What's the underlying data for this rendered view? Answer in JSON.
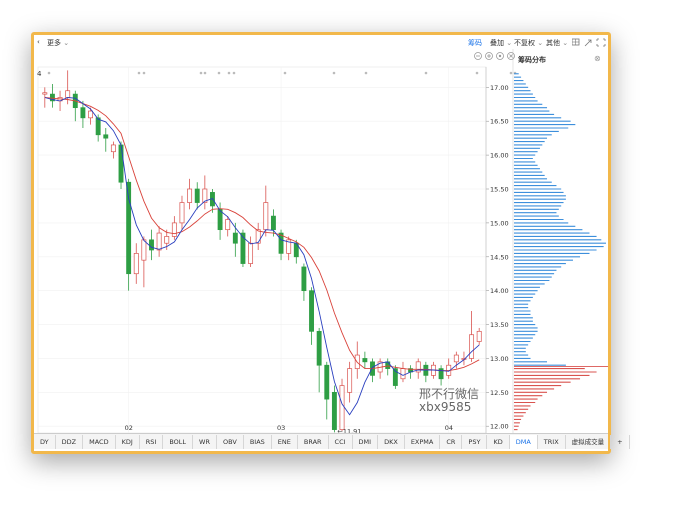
{
  "toolbar": {
    "back": "‹",
    "more": "更多",
    "active_tab": "筹码",
    "overlay": "叠加",
    "adjust": "不复权",
    "other": "其他",
    "dropdown_glyph": "⌄"
  },
  "panel": {
    "title": "筹码分布",
    "close": "⊗"
  },
  "watermark": {
    "line1": "邢不行微信",
    "line2": "xbx9585"
  },
  "top_marker": "4",
  "chart_data": {
    "type": "candlestick",
    "x_labels": [
      "02",
      "03",
      "04"
    ],
    "y_ticks": [
      "17.00",
      "16.50",
      "16.00",
      "15.50",
      "15.00",
      "14.50",
      "14.00",
      "13.50",
      "13.00",
      "12.50",
      "12.00"
    ],
    "y_range": [
      11.9,
      17.3
    ],
    "low_marker": "11.91",
    "candles": [
      [
        16.9,
        16.92,
        16.7,
        17.0
      ],
      [
        16.9,
        16.8,
        16.7,
        17.05
      ],
      [
        16.8,
        16.85,
        16.65,
        16.95
      ],
      [
        16.85,
        16.95,
        16.75,
        17.25
      ],
      [
        16.9,
        16.7,
        16.5,
        16.95
      ],
      [
        16.7,
        16.55,
        16.4,
        16.8
      ],
      [
        16.55,
        16.65,
        16.45,
        16.7
      ],
      [
        16.55,
        16.3,
        16.2,
        16.6
      ],
      [
        16.3,
        16.25,
        16.05,
        16.4
      ],
      [
        16.05,
        16.15,
        15.95,
        16.2
      ],
      [
        16.15,
        15.6,
        15.5,
        16.2
      ],
      [
        15.6,
        14.25,
        14.0,
        15.65
      ],
      [
        14.25,
        14.55,
        14.1,
        14.7
      ],
      [
        14.45,
        14.75,
        14.05,
        14.8
      ],
      [
        14.75,
        14.6,
        14.45,
        14.9
      ],
      [
        14.6,
        14.85,
        14.5,
        14.95
      ],
      [
        14.7,
        14.8,
        14.6,
        14.9
      ],
      [
        14.8,
        15.0,
        14.75,
        15.1
      ],
      [
        15.0,
        15.3,
        14.9,
        15.4
      ],
      [
        15.3,
        15.5,
        15.2,
        15.65
      ],
      [
        15.5,
        15.3,
        15.2,
        15.6
      ],
      [
        15.3,
        15.5,
        15.2,
        15.7
      ],
      [
        15.45,
        15.25,
        15.15,
        15.5
      ],
      [
        15.2,
        14.9,
        14.75,
        15.3
      ],
      [
        14.9,
        15.05,
        14.8,
        15.1
      ],
      [
        14.85,
        14.7,
        14.5,
        15.0
      ],
      [
        14.85,
        14.4,
        14.35,
        14.9
      ],
      [
        14.4,
        14.7,
        14.35,
        14.8
      ],
      [
        14.7,
        14.9,
        14.6,
        15.0
      ],
      [
        14.9,
        15.3,
        14.8,
        15.55
      ],
      [
        15.1,
        14.9,
        14.8,
        15.2
      ],
      [
        14.85,
        14.55,
        14.45,
        14.9
      ],
      [
        14.55,
        14.75,
        14.45,
        14.8
      ],
      [
        14.7,
        14.5,
        14.4,
        14.75
      ],
      [
        14.35,
        14.0,
        13.85,
        14.4
      ],
      [
        14.0,
        13.4,
        13.2,
        14.05
      ],
      [
        13.4,
        12.9,
        12.5,
        13.45
      ],
      [
        12.9,
        12.4,
        12.1,
        12.95
      ],
      [
        12.5,
        11.95,
        11.91,
        12.6
      ],
      [
        11.95,
        12.6,
        11.93,
        12.7
      ],
      [
        12.5,
        12.85,
        12.35,
        12.95
      ],
      [
        12.85,
        13.05,
        12.7,
        13.25
      ],
      [
        13.0,
        12.95,
        12.85,
        13.1
      ],
      [
        12.95,
        12.75,
        12.65,
        13.0
      ],
      [
        12.8,
        12.95,
        12.7,
        13.0
      ],
      [
        12.95,
        12.85,
        12.75,
        13.0
      ],
      [
        12.85,
        12.6,
        12.55,
        12.9
      ],
      [
        12.7,
        12.85,
        12.65,
        12.95
      ],
      [
        12.85,
        12.8,
        12.7,
        12.9
      ],
      [
        12.8,
        12.95,
        12.7,
        13.0
      ],
      [
        12.9,
        12.75,
        12.65,
        12.95
      ],
      [
        12.75,
        12.9,
        12.7,
        12.95
      ],
      [
        12.85,
        12.7,
        12.6,
        12.9
      ],
      [
        12.75,
        12.9,
        12.7,
        13.0
      ],
      [
        12.95,
        13.05,
        12.85,
        13.1
      ],
      [
        13.0,
        13.0,
        12.9,
        13.1
      ],
      [
        13.0,
        13.35,
        12.95,
        13.7
      ],
      [
        13.25,
        13.4,
        13.2,
        13.45
      ]
    ],
    "ma_short": [
      16.85,
      16.82,
      16.8,
      16.85,
      16.84,
      16.76,
      16.68,
      16.53,
      16.49,
      16.36,
      16.15,
      15.36,
      14.97,
      14.74,
      14.64,
      14.61,
      14.65,
      14.72,
      14.9,
      15.05,
      15.22,
      15.32,
      15.36,
      15.18,
      15.09,
      14.93,
      14.79,
      14.69,
      14.71,
      14.9,
      14.89,
      14.75,
      14.72,
      14.7,
      14.53,
      14.18,
      13.69,
      13.16,
      12.66,
      12.33,
      12.17,
      12.35,
      12.65,
      12.87,
      12.93,
      12.95,
      12.81,
      12.75,
      12.8,
      12.83,
      12.83,
      12.83,
      12.82,
      12.81,
      12.9,
      12.98,
      13.1,
      13.2
    ],
    "ma_long": [
      16.85,
      16.84,
      16.83,
      16.82,
      16.8,
      16.76,
      16.72,
      16.66,
      16.58,
      16.46,
      16.32,
      15.98,
      15.63,
      15.32,
      15.07,
      14.93,
      14.86,
      14.84,
      14.87,
      14.94,
      15.03,
      15.13,
      15.2,
      15.21,
      15.2,
      15.15,
      15.08,
      14.97,
      14.88,
      14.86,
      14.85,
      14.82,
      14.77,
      14.72,
      14.64,
      14.49,
      14.29,
      14.01,
      13.67,
      13.38,
      13.12,
      12.94,
      12.85,
      12.85,
      12.87,
      12.89,
      12.87,
      12.85,
      12.84,
      12.84,
      12.84,
      12.83,
      12.82,
      12.82,
      12.84,
      12.87,
      12.92,
      12.98
    ],
    "chip_distribution": [
      [
        17.2,
        4
      ],
      [
        17.15,
        6
      ],
      [
        17.1,
        8
      ],
      [
        17.05,
        10
      ],
      [
        17.0,
        12
      ],
      [
        16.95,
        14
      ],
      [
        16.9,
        16
      ],
      [
        16.85,
        18
      ],
      [
        16.8,
        20
      ],
      [
        16.75,
        24
      ],
      [
        16.7,
        28
      ],
      [
        16.65,
        30
      ],
      [
        16.6,
        34
      ],
      [
        16.55,
        40
      ],
      [
        16.5,
        48
      ],
      [
        16.45,
        52
      ],
      [
        16.4,
        46
      ],
      [
        16.35,
        38
      ],
      [
        16.3,
        32
      ],
      [
        16.25,
        28
      ],
      [
        16.2,
        26
      ],
      [
        16.15,
        24
      ],
      [
        16.1,
        22
      ],
      [
        16.05,
        20
      ],
      [
        16.0,
        18
      ],
      [
        15.95,
        16
      ],
      [
        15.9,
        18
      ],
      [
        15.85,
        20
      ],
      [
        15.8,
        22
      ],
      [
        15.75,
        24
      ],
      [
        15.7,
        26
      ],
      [
        15.65,
        28
      ],
      [
        15.6,
        32
      ],
      [
        15.55,
        36
      ],
      [
        15.5,
        40
      ],
      [
        15.45,
        42
      ],
      [
        15.4,
        44
      ],
      [
        15.35,
        44
      ],
      [
        15.3,
        42
      ],
      [
        15.25,
        40
      ],
      [
        15.2,
        38
      ],
      [
        15.15,
        36
      ],
      [
        15.1,
        38
      ],
      [
        15.05,
        42
      ],
      [
        15.0,
        46
      ],
      [
        14.95,
        52
      ],
      [
        14.9,
        58
      ],
      [
        14.85,
        64
      ],
      [
        14.8,
        70
      ],
      [
        14.75,
        74
      ],
      [
        14.7,
        78
      ],
      [
        14.65,
        76
      ],
      [
        14.6,
        70
      ],
      [
        14.55,
        64
      ],
      [
        14.5,
        56
      ],
      [
        14.45,
        50
      ],
      [
        14.4,
        44
      ],
      [
        14.35,
        40
      ],
      [
        14.3,
        36
      ],
      [
        14.25,
        34
      ],
      [
        14.2,
        32
      ],
      [
        14.15,
        30
      ],
      [
        14.1,
        26
      ],
      [
        14.05,
        22
      ],
      [
        14.0,
        20
      ],
      [
        13.95,
        18
      ],
      [
        13.9,
        16
      ],
      [
        13.85,
        14
      ],
      [
        13.8,
        12
      ],
      [
        13.75,
        12
      ],
      [
        13.7,
        14
      ],
      [
        13.65,
        14
      ],
      [
        13.6,
        16
      ],
      [
        13.55,
        16
      ],
      [
        13.5,
        18
      ],
      [
        13.45,
        20
      ],
      [
        13.4,
        20
      ],
      [
        13.35,
        18
      ],
      [
        13.3,
        16
      ],
      [
        13.25,
        14
      ],
      [
        13.2,
        12
      ],
      [
        13.15,
        10
      ],
      [
        13.1,
        10
      ],
      [
        13.05,
        12
      ],
      [
        13.0,
        14
      ],
      [
        12.95,
        28
      ],
      [
        12.9,
        44
      ],
      [
        12.85,
        60
      ],
      [
        12.8,
        70
      ],
      [
        12.75,
        64
      ],
      [
        12.7,
        56
      ],
      [
        12.65,
        48
      ],
      [
        12.6,
        40
      ],
      [
        12.55,
        34
      ],
      [
        12.5,
        28
      ],
      [
        12.45,
        24
      ],
      [
        12.4,
        20
      ],
      [
        12.35,
        18
      ],
      [
        12.3,
        14
      ],
      [
        12.25,
        12
      ],
      [
        12.2,
        10
      ],
      [
        12.15,
        8
      ],
      [
        12.1,
        6
      ],
      [
        12.05,
        5
      ],
      [
        12.0,
        4
      ],
      [
        11.95,
        3
      ]
    ],
    "current_price": 12.88,
    "colors": {
      "up": "#d9534f",
      "down": "#2e9e44",
      "ma_short": "#2a3fbf",
      "ma_long": "#d9423a",
      "chip_profit": "#d9534f",
      "chip_loss": "#3d8fdc",
      "price_line": "#d9534f"
    }
  },
  "indicator_tabs": [
    "DY",
    "DDZ",
    "MACD",
    "KDJ",
    "RSI",
    "BOLL",
    "WR",
    "OBV",
    "BIAS",
    "ENE",
    "BRAR",
    "CCI",
    "DMI",
    "DKX",
    "EXPMA",
    "CR",
    "PSY",
    "KD",
    "DMA",
    "TRIX",
    "虚拟成交量",
    "+"
  ],
  "active_indicator": "DMA"
}
